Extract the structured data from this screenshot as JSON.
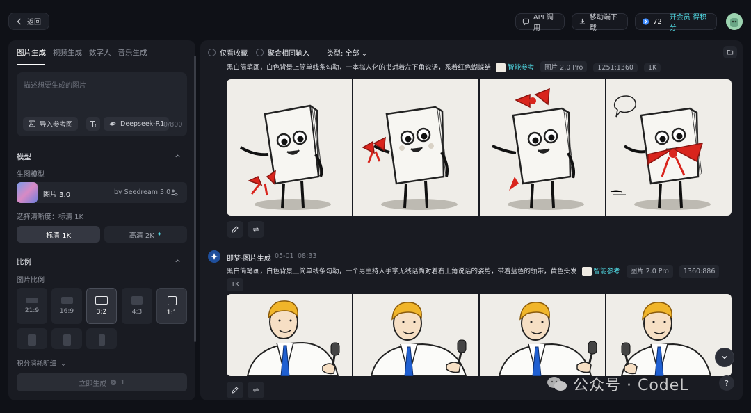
{
  "header": {
    "back_label": "返回",
    "api_label": "API 调用",
    "download_label": "移动端下载",
    "points": "72",
    "vip_label": "开会员 得积分"
  },
  "left": {
    "tabs": [
      "图片生成",
      "视频生成",
      "数字人",
      "音乐生成"
    ],
    "prompt_placeholder": "描述想要生成的图片",
    "import_ref_label": "导入参考图",
    "model_engine_label": "Deepseek-R1",
    "char_count": "0/800",
    "model_section": "模型",
    "gen_model_label": "生图模型",
    "model_name": "图片 3.0",
    "model_by": "by Seedream 3.0",
    "clarity_label": "选择清晰度：标清 1K",
    "clarity_options": [
      "标清 1K",
      "高清 2K"
    ],
    "ratio_section": "比例",
    "ratio_sub_label": "图片比例",
    "ratios": [
      "21:9",
      "16:9",
      "3:2",
      "4:3",
      "1:1"
    ],
    "cost_detail_label": "积分消耗明细",
    "generate_label": "立即生成",
    "generate_cost": "1"
  },
  "right": {
    "filter_favorites": "仅看收藏",
    "filter_merge": "聚合相同输入",
    "type_filter": "类型: 全部",
    "group1": {
      "prompt": "黑白简笔画，白色背景上简单线条勾勒，一本拟人化的书对着左下角说话，系着红色蝴蝶结",
      "smart_ref": "智能参考",
      "model_tag": "图片 2.0 Pro",
      "size_tag": "1251:1360",
      "res_tag": "1K"
    },
    "group2": {
      "author": "即梦-图片生成",
      "date": "05-01",
      "time": "08:33",
      "prompt": "黑白简笔画，白色背景上简单线条勾勒，一个男主持人手拿无线话筒对着右上角说话的姿势，带着蓝色的领带，黄色头发",
      "smart_ref": "智能参考",
      "model_tag": "图片 2.0 Pro",
      "size_tag": "1360:886",
      "res_tag": "1K"
    }
  },
  "watermark": "公众号 · CodeL",
  "colors": {
    "accent_blue": "#3d8bff",
    "accent_cyan": "#4fd6e0",
    "bow_red": "#d9251d",
    "tie_blue": "#1f5fd1",
    "hair_yellow": "#f0b52a"
  }
}
